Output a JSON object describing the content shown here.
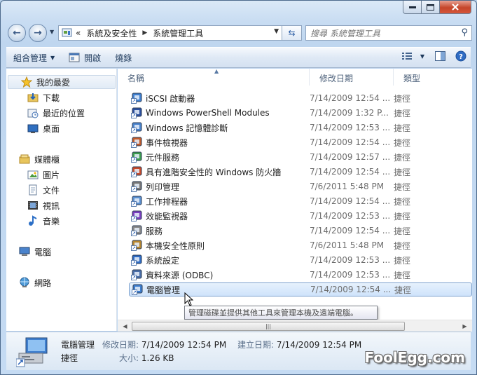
{
  "address": {
    "overflow": "«",
    "crumbs": [
      "系統及安全性",
      "系統管理工具"
    ]
  },
  "search": {
    "placeholder": "搜尋 系統管理工具"
  },
  "toolbar": {
    "organize": "組合管理",
    "open": "開啟",
    "burn": "燒錄"
  },
  "navpane": {
    "favorites": "我的最愛",
    "downloads": "下載",
    "recent": "最近的位置",
    "desktop": "桌面",
    "libraries": "媒體櫃",
    "pictures": "圖片",
    "documents": "文件",
    "videos": "視訊",
    "music": "音樂",
    "computer": "電腦",
    "network": "網路"
  },
  "columns": {
    "name": "名稱",
    "date": "修改日期",
    "type": "類型"
  },
  "files": [
    {
      "name": "iSCSI 啟動器",
      "date": "7/14/2009 12:54 ...",
      "type": "捷徑",
      "icon": "iscsi-icon"
    },
    {
      "name": "Windows PowerShell Modules",
      "date": "7/14/2009 1:32 P...",
      "type": "捷徑",
      "icon": "powershell-icon"
    },
    {
      "name": "Windows 記憶體診斷",
      "date": "7/14/2009 12:53 ...",
      "type": "捷徑",
      "icon": "memory-diagnostic-icon"
    },
    {
      "name": "事件檢視器",
      "date": "7/14/2009 12:54 ...",
      "type": "捷徑",
      "icon": "event-viewer-icon"
    },
    {
      "name": "元件服務",
      "date": "7/14/2009 12:57 ...",
      "type": "捷徑",
      "icon": "component-services-icon"
    },
    {
      "name": "具有進階安全性的 Windows 防火牆",
      "date": "7/14/2009 12:54 ...",
      "type": "捷徑",
      "icon": "firewall-icon"
    },
    {
      "name": "列印管理",
      "date": "7/6/2011 5:48 PM",
      "type": "捷徑",
      "icon": "print-management-icon"
    },
    {
      "name": "工作排程器",
      "date": "7/14/2009 12:54 ...",
      "type": "捷徑",
      "icon": "task-scheduler-icon"
    },
    {
      "name": "效能監視器",
      "date": "7/14/2009 12:53 ...",
      "type": "捷徑",
      "icon": "performance-monitor-icon"
    },
    {
      "name": "服務",
      "date": "7/14/2009 12:54 ...",
      "type": "捷徑",
      "icon": "services-icon"
    },
    {
      "name": "本機安全性原則",
      "date": "7/6/2011 5:48 PM",
      "type": "捷徑",
      "icon": "security-policy-icon"
    },
    {
      "name": "系統設定",
      "date": "7/14/2009 12:53 ...",
      "type": "捷徑",
      "icon": "system-config-icon"
    },
    {
      "name": "資料來源 (ODBC)",
      "date": "7/14/2009 12:53 ...",
      "type": "捷徑",
      "icon": "odbc-icon"
    },
    {
      "name": "電腦管理",
      "date": "7/14/2009 12:54 ...",
      "type": "捷徑",
      "icon": "computer-management-icon",
      "selected": true
    }
  ],
  "tooltip": "管理磁碟並提供其他工具來管理本機及遠端電腦。",
  "details": {
    "name": "電腦管理",
    "type": "捷徑",
    "modified_label": "修改日期:",
    "modified_value": "7/14/2009 12:54 PM",
    "size_label": "大小:",
    "size_value": "1.26 KB",
    "created_label": "建立日期:",
    "created_value": "7/14/2009 12:54 PM"
  },
  "watermark": "FoolEgg.com"
}
